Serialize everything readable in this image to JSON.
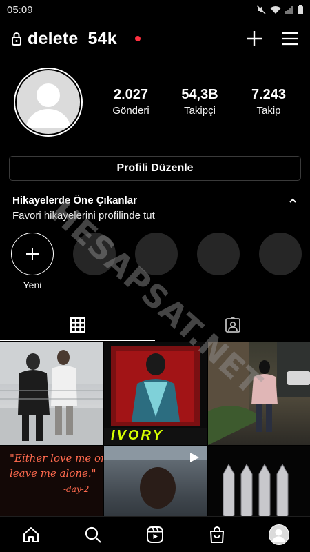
{
  "status_bar": {
    "time": "05:09"
  },
  "profile": {
    "username": "delete_54k",
    "stats": [
      {
        "value": "2.027",
        "label": "Gönderi"
      },
      {
        "value": "54,3B",
        "label": "Takipçi"
      },
      {
        "value": "7.243",
        "label": "Takip"
      }
    ],
    "edit_button": "Profili Düzenle"
  },
  "highlights": {
    "title": "Hikayelerde Öne Çıkanlar",
    "subtitle": "Favori hikayelerini profilinde tut",
    "new_label": "Yeni"
  },
  "watermark": "HESAPSAT.NET",
  "tabs": [
    {
      "icon": "grid-icon",
      "active": true
    },
    {
      "icon": "tagged-icon",
      "active": false
    }
  ],
  "post_cells": {
    "cell2_title": "IVORY"
  },
  "bottom_nav": [
    "home-icon",
    "search-icon",
    "reels-icon",
    "shop-icon",
    "profile-avatar"
  ],
  "colors": {
    "background": "#000000",
    "accent_dot": "#ff3040",
    "button_border": "#3a3a3a"
  }
}
